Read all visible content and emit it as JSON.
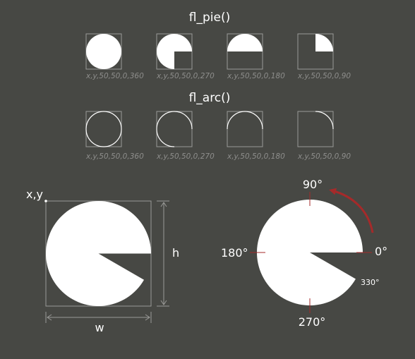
{
  "pie_section": {
    "title": "fl_pie()",
    "examples": [
      {
        "caption": "x,y,50,50,0,360",
        "start": 0,
        "end": 360
      },
      {
        "caption": "x,y,50,50,0,270",
        "start": 0,
        "end": 270
      },
      {
        "caption": "x,y,50,50,0,180",
        "start": 0,
        "end": 180
      },
      {
        "caption": "x,y,50,50,0,90",
        "start": 0,
        "end": 90
      }
    ]
  },
  "arc_section": {
    "title": "fl_arc()",
    "examples": [
      {
        "caption": "x,y,50,50,0,360",
        "start": 0,
        "end": 360
      },
      {
        "caption": "x,y,50,50,0,270",
        "start": 0,
        "end": 270
      },
      {
        "caption": "x,y,50,50,0,180",
        "start": 0,
        "end": 180
      },
      {
        "caption": "x,y,50,50,0,90",
        "start": 0,
        "end": 90
      }
    ]
  },
  "dimension_diagram": {
    "origin_label": "x,y",
    "width_label": "w",
    "height_label": "h",
    "start": 0,
    "end": 330
  },
  "angle_diagram": {
    "labels": {
      "deg0": "0°",
      "deg90": "90°",
      "deg180": "180°",
      "deg270": "270°",
      "deg330": "330°"
    },
    "start": 0,
    "end": 330
  },
  "colors": {
    "background": "#474844",
    "fill": "#ffffff",
    "box": "#9a9a98",
    "accent": "#a52a2a"
  }
}
